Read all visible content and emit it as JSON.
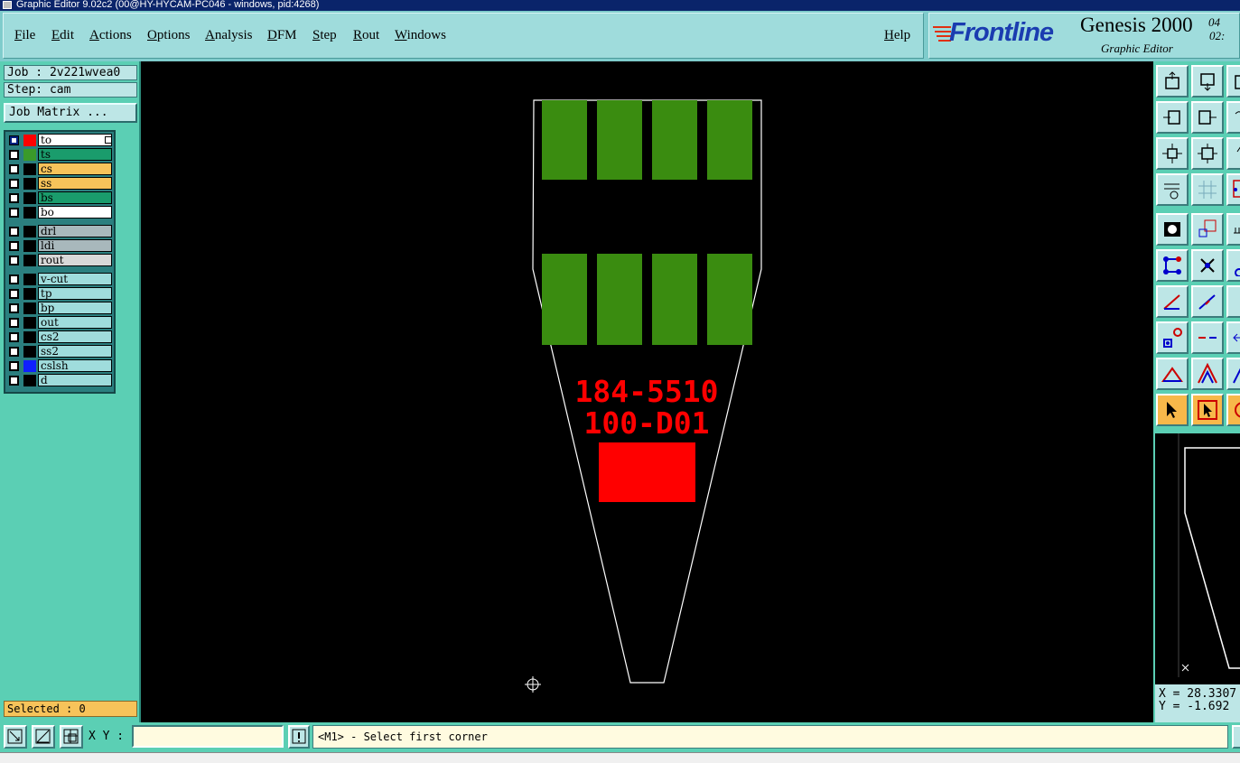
{
  "window": {
    "title": "Graphic Editor 9.02c2 (00@HY-HYCAM-PC046 - windows, pid:4268)"
  },
  "menu": {
    "items": [
      "File",
      "Edit",
      "Actions",
      "Options",
      "Analysis",
      "DFM",
      "Step",
      "Rout",
      "Windows"
    ],
    "help": "Help"
  },
  "brand": {
    "logo": "Frontline",
    "product": "Genesis 2000",
    "subtitle": "Graphic Editor",
    "date_partial": "04",
    "time_partial": "02:"
  },
  "job": {
    "job_line": "Job : 2v221wvea0",
    "step_line": "Step: cam",
    "matrix_button": "Job Matrix ..."
  },
  "layers": [
    {
      "name": "to",
      "bg": "#ffffff",
      "swatch": "#ff0000",
      "active": true
    },
    {
      "name": "ts",
      "bg": "#1a9c6c",
      "swatch": "#3a9a2a",
      "active": false
    },
    {
      "name": "cs",
      "bg": "#f7c35a",
      "swatch": "",
      "active": false
    },
    {
      "name": "ss",
      "bg": "#f7c35a",
      "swatch": "",
      "active": false
    },
    {
      "name": "bs",
      "bg": "#1a9c6c",
      "swatch": "",
      "active": false
    },
    {
      "name": "bo",
      "bg": "#ffffff",
      "swatch": "",
      "active": false
    },
    {
      "name": "drl",
      "bg": "#a8b8bc",
      "swatch": "",
      "active": false
    },
    {
      "name": "ldi",
      "bg": "#a8b8bc",
      "swatch": "",
      "active": false
    },
    {
      "name": "rout",
      "bg": "#d8d8d8",
      "swatch": "",
      "active": false
    },
    {
      "name": "v-cut",
      "bg": "#9fdcdc",
      "swatch": "",
      "active": false
    },
    {
      "name": "tp",
      "bg": "#9fdcdc",
      "swatch": "",
      "active": false
    },
    {
      "name": "bp",
      "bg": "#9fdcdc",
      "swatch": "",
      "active": false
    },
    {
      "name": "out",
      "bg": "#9fdcdc",
      "swatch": "",
      "active": false
    },
    {
      "name": "cs2",
      "bg": "#9fdcdc",
      "swatch": "",
      "active": false
    },
    {
      "name": "ss2",
      "bg": "#9fdcdc",
      "swatch": "",
      "active": false
    },
    {
      "name": "cslsh",
      "bg": "#9fdcdc",
      "swatch": "#1020ff",
      "active": false
    },
    {
      "name": "d",
      "bg": "#9fdcdc",
      "swatch": "",
      "active": false
    }
  ],
  "selected": "Selected : 0",
  "canvas": {
    "text_line1": "184-5510",
    "text_line2": "100-D01",
    "colors": {
      "pads": "#3a8c10",
      "text": "#ff0000",
      "outline": "#ffffff"
    }
  },
  "coords": {
    "x": "X = 28.3307",
    "y": "Y = -1.692"
  },
  "bottom": {
    "xy_label": "X Y :",
    "xy_value": "",
    "message": "<M1> - Select first corner"
  }
}
